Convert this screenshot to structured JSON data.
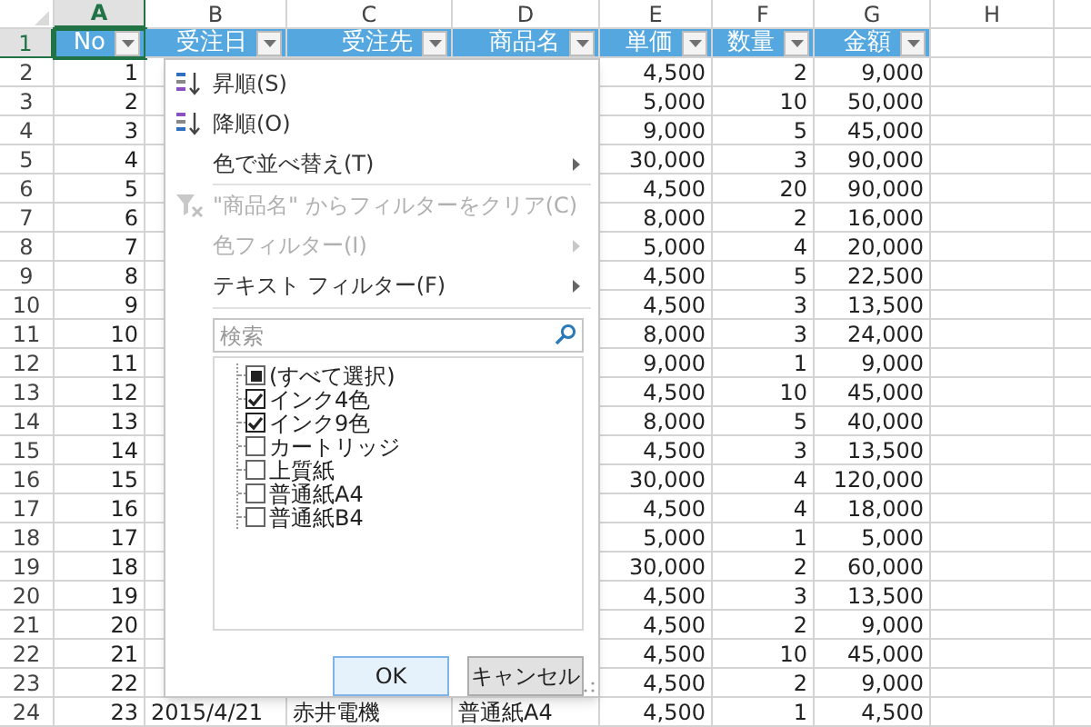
{
  "columns": [
    {
      "label": "A",
      "selected": true
    },
    {
      "label": "B",
      "selected": false
    },
    {
      "label": "C",
      "selected": false
    },
    {
      "label": "D",
      "selected": false
    },
    {
      "label": "E",
      "selected": false
    },
    {
      "label": "F",
      "selected": false
    },
    {
      "label": "G",
      "selected": false
    },
    {
      "label": "H",
      "selected": false
    }
  ],
  "header_row": {
    "row": "1",
    "selected": true,
    "cells": [
      {
        "label": "No",
        "selected": true
      },
      {
        "label": "受注日",
        "selected": false
      },
      {
        "label": "受注先",
        "selected": false
      },
      {
        "label": "商品名",
        "selected": false
      },
      {
        "label": "単価",
        "selected": false
      },
      {
        "label": "数量",
        "selected": false
      },
      {
        "label": "金額",
        "selected": false
      }
    ]
  },
  "rows": [
    {
      "row": "2",
      "a": "1",
      "e": "4,500",
      "f": "2",
      "g": "9,000"
    },
    {
      "row": "3",
      "a": "2",
      "e": "5,000",
      "f": "10",
      "g": "50,000"
    },
    {
      "row": "4",
      "a": "3",
      "e": "9,000",
      "f": "5",
      "g": "45,000"
    },
    {
      "row": "5",
      "a": "4",
      "e": "30,000",
      "f": "3",
      "g": "90,000"
    },
    {
      "row": "6",
      "a": "5",
      "e": "4,500",
      "f": "20",
      "g": "90,000"
    },
    {
      "row": "7",
      "a": "6",
      "e": "8,000",
      "f": "2",
      "g": "16,000"
    },
    {
      "row": "8",
      "a": "7",
      "e": "5,000",
      "f": "4",
      "g": "20,000"
    },
    {
      "row": "9",
      "a": "8",
      "e": "4,500",
      "f": "5",
      "g": "22,500"
    },
    {
      "row": "10",
      "a": "9",
      "e": "4,500",
      "f": "3",
      "g": "13,500"
    },
    {
      "row": "11",
      "a": "10",
      "e": "8,000",
      "f": "3",
      "g": "24,000"
    },
    {
      "row": "12",
      "a": "11",
      "e": "9,000",
      "f": "1",
      "g": "9,000"
    },
    {
      "row": "13",
      "a": "12",
      "e": "4,500",
      "f": "10",
      "g": "45,000"
    },
    {
      "row": "14",
      "a": "13",
      "e": "8,000",
      "f": "5",
      "g": "40,000"
    },
    {
      "row": "15",
      "a": "14",
      "e": "4,500",
      "f": "3",
      "g": "13,500"
    },
    {
      "row": "16",
      "a": "15",
      "e": "30,000",
      "f": "4",
      "g": "120,000"
    },
    {
      "row": "17",
      "a": "16",
      "e": "4,500",
      "f": "4",
      "g": "18,000"
    },
    {
      "row": "18",
      "a": "17",
      "e": "5,000",
      "f": "1",
      "g": "5,000"
    },
    {
      "row": "19",
      "a": "18",
      "e": "30,000",
      "f": "2",
      "g": "60,000"
    },
    {
      "row": "20",
      "a": "19",
      "e": "4,500",
      "f": "3",
      "g": "13,500"
    },
    {
      "row": "21",
      "a": "20",
      "e": "4,500",
      "f": "2",
      "g": "9,000"
    },
    {
      "row": "22",
      "a": "21",
      "e": "4,500",
      "f": "10",
      "g": "45,000"
    },
    {
      "row": "23",
      "a": "22",
      "e": "4,500",
      "f": "2",
      "g": "9,000"
    },
    {
      "row": "24",
      "a": "23",
      "b": "2015/4/21",
      "c": "赤井電機",
      "d": "普通紙A4",
      "e": "4,500",
      "f": "1",
      "g": "4,500"
    }
  ],
  "filter_menu": {
    "items": [
      {
        "label": "昇順(S)",
        "kind": "sort_asc",
        "disabled": false,
        "submenu": false,
        "separator_after": false
      },
      {
        "label": "降順(O)",
        "kind": "sort_desc",
        "disabled": false,
        "submenu": false,
        "separator_after": false
      },
      {
        "label": "色で並べ替え(T)",
        "kind": "plain",
        "disabled": false,
        "submenu": true,
        "separator_after": true
      },
      {
        "label": "\"商品名\" からフィルターをクリア(C)",
        "kind": "clear_filter",
        "disabled": true,
        "submenu": false,
        "separator_after": false
      },
      {
        "label": "色フィルター(I)",
        "kind": "plain",
        "disabled": true,
        "submenu": true,
        "separator_after": false
      },
      {
        "label": "テキスト フィルター(F)",
        "kind": "plain",
        "disabled": false,
        "submenu": true,
        "separator_after": false
      }
    ],
    "search": {
      "placeholder": "検索"
    },
    "values": [
      {
        "label": "(すべて選択)",
        "checked": false,
        "indeterminate": true
      },
      {
        "label": "インク4色",
        "checked": true,
        "indeterminate": false
      },
      {
        "label": "インク9色",
        "checked": true,
        "indeterminate": false
      },
      {
        "label": "カートリッジ",
        "checked": false,
        "indeterminate": false
      },
      {
        "label": "上質紙",
        "checked": false,
        "indeterminate": false
      },
      {
        "label": "普通紙A4",
        "checked": false,
        "indeterminate": false
      },
      {
        "label": "普通紙B4",
        "checked": false,
        "indeterminate": false
      }
    ],
    "buttons": [
      {
        "label": "OK",
        "selected": true
      },
      {
        "label": "キャンセル",
        "selected": false
      }
    ]
  }
}
